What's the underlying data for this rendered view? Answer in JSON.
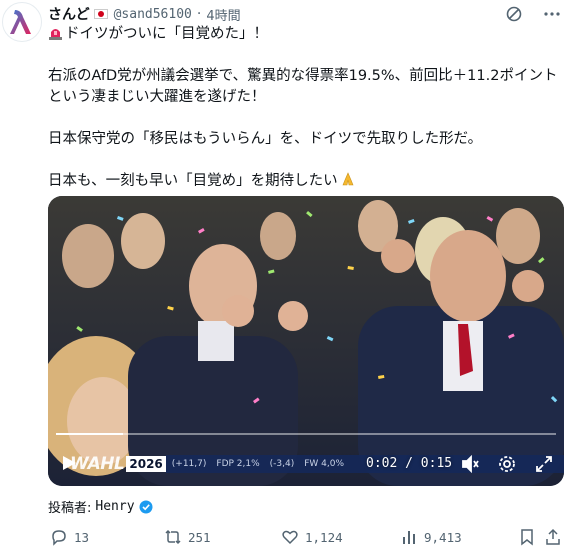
{
  "author": {
    "display_name": "さんど",
    "handle": "@sand56100",
    "separator": "·",
    "time_ago": "4時間"
  },
  "tweet": {
    "line1": "ドイツがついに「目覚めた」！",
    "paragraph2": "右派のAfD党が州議会選挙で、驚異的な得票率19.5%、前回比＋11.2ポイントという凄まじい大躍進を遂げた！",
    "paragraph3": "日本保守党の「移民はもういらん」を、ドイツで先取りした形だ。",
    "paragraph4": "日本も、一刻も早い「目覚め」を期待したい"
  },
  "video": {
    "progress": 0.133,
    "current_time": "0:02",
    "time_sep": "/",
    "duration": "0:15",
    "ticker_brand": "WAHL",
    "ticker_year": "2026",
    "ticker_items": [
      "(+11,7)",
      "FDP 2,1%",
      "(-3,4)",
      "FW 4,0%"
    ]
  },
  "posted_by": {
    "label": "投稿者:",
    "name": "Henry"
  },
  "actions": {
    "replies": "13",
    "reposts": "251",
    "likes": "1,124",
    "views": "9,413"
  },
  "colors": {
    "text_primary": "#0f1419",
    "text_secondary": "#536471",
    "verified_blue": "#1d9bf0",
    "accent_red": "#d0021b"
  },
  "icons": [
    "avatar-logo-icon",
    "japan-flag-icon",
    "translate-icon",
    "more-icon",
    "siren-icon",
    "pray-icon",
    "play-icon",
    "volume-icon",
    "settings-icon",
    "fullscreen-icon",
    "verified-icon",
    "reply-icon",
    "repost-icon",
    "like-icon",
    "views-icon",
    "bookmark-icon",
    "share-icon"
  ]
}
